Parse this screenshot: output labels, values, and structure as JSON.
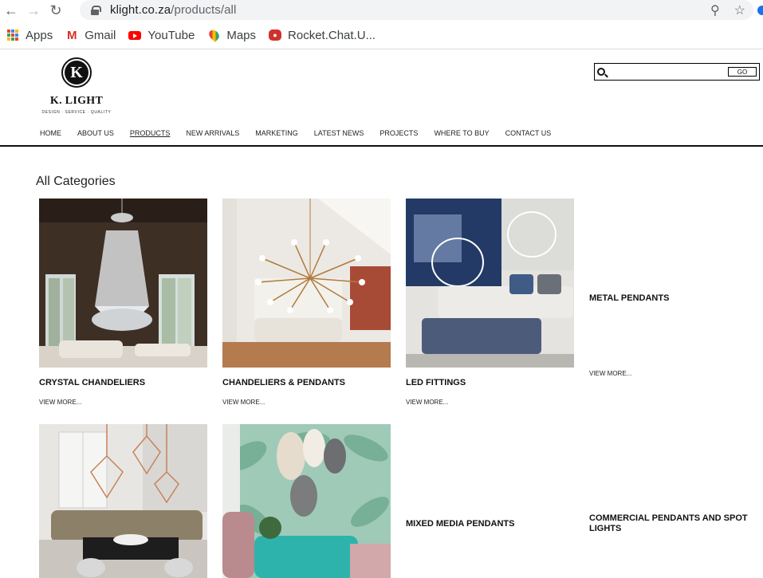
{
  "browser": {
    "url_host": "klight.co.za",
    "url_path": "/products/all",
    "bookmarks": [
      {
        "label": "Apps",
        "icon": "apps-grid-icon"
      },
      {
        "label": "Gmail",
        "icon": "gmail-icon"
      },
      {
        "label": "YouTube",
        "icon": "youtube-icon"
      },
      {
        "label": "Maps",
        "icon": "maps-icon"
      },
      {
        "label": "Rocket.Chat.U...",
        "icon": "rocketchat-icon"
      }
    ]
  },
  "site": {
    "logo_mark": "K",
    "logo_name": "K. LIGHT",
    "logo_tagline": "DESIGN · SERVICE · QUALITY",
    "search_button": "GO",
    "nav": [
      "HOME",
      "ABOUT US",
      "PRODUCTS",
      "NEW ARRIVALS",
      "MARKETING",
      "LATEST NEWS",
      "PROJECTS",
      "WHERE TO BUY",
      "CONTACT US"
    ],
    "active_nav": "PRODUCTS"
  },
  "page": {
    "title": "All Categories",
    "categories": [
      {
        "label": "CRYSTAL CHANDELIERS",
        "link": "VIEW MORE..."
      },
      {
        "label": "CHANDELIERS & PENDANTS",
        "link": "VIEW MORE..."
      },
      {
        "label": "LED FITTINGS",
        "link": "VIEW MORE..."
      },
      {
        "label": "METAL PENDANTS",
        "link": "VIEW MORE..."
      },
      {
        "label": "",
        "link": ""
      },
      {
        "label": "",
        "link": ""
      },
      {
        "label": "MIXED MEDIA PENDANTS",
        "link": ""
      },
      {
        "label": "COMMERCIAL PENDANTS AND SPOT LIGHTS",
        "link": ""
      }
    ]
  }
}
